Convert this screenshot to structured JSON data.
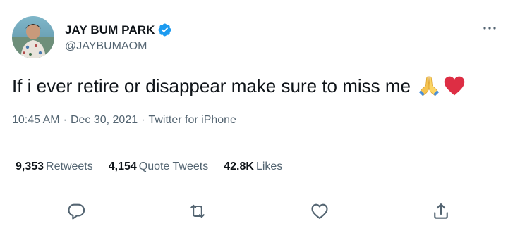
{
  "author": {
    "display_name": "JAY BUM PARK",
    "handle": "@JAYBUMAOM",
    "verified": true,
    "avatar_icon": "profile-photo"
  },
  "tweet": {
    "text": "If i ever retire or disappear make sure to miss me",
    "emojis": [
      "folded-hands",
      "red-heart"
    ]
  },
  "meta": {
    "time": "10:45 AM",
    "separator1": "·",
    "date": "Dec 30, 2021",
    "separator2": "·",
    "source": "Twitter for iPhone"
  },
  "stats": {
    "retweets_count": "9,353",
    "retweets_label": "Retweets",
    "quotes_count": "4,154",
    "quotes_label": "Quote Tweets",
    "likes_count": "42.8K",
    "likes_label": "Likes"
  },
  "actions": [
    "reply-icon",
    "retweet-icon",
    "like-icon",
    "share-icon"
  ],
  "colors": {
    "text": "#0f1419",
    "secondary": "#536471",
    "verified": "#1d9bf0",
    "divider": "#eff3f4"
  }
}
